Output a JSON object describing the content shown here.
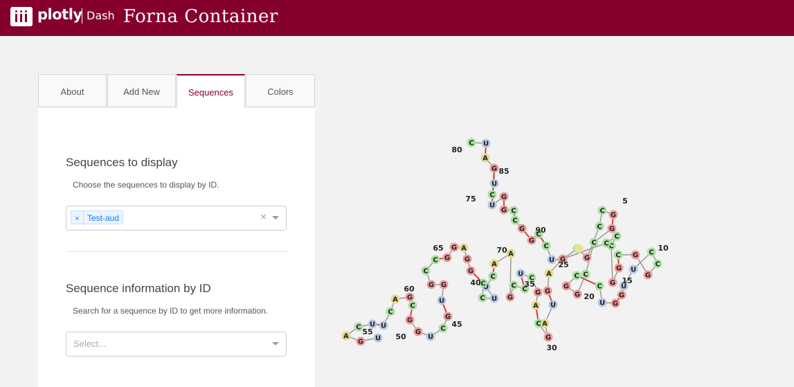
{
  "header": {
    "logo_text": "plotly",
    "logo_product": "Dash",
    "title": "Forna Container",
    "background": "#85002d"
  },
  "tabs": [
    {
      "label": "About",
      "active": false
    },
    {
      "label": "Add New",
      "active": false
    },
    {
      "label": "Sequences",
      "active": true
    },
    {
      "label": "Colors",
      "active": false
    }
  ],
  "sequences_section": {
    "title": "Sequences to display",
    "description": "Choose the sequences to display by ID.",
    "selected_chip": "Test-aud",
    "clear_icon": "×",
    "remove_icon": "×"
  },
  "info_section": {
    "title": "Sequence information by ID",
    "description": "Search for a sequence by ID to get more information.",
    "placeholder": "Select..."
  },
  "colors": {
    "accent": "#85002d",
    "G": "#ee9b9b",
    "C": "#a8e0a0",
    "U": "#b5c8e6",
    "A": "#e6d98c"
  },
  "nucleotides": [
    {
      "b": "C"
    },
    {
      "b": "U"
    },
    {
      "b": "A"
    },
    {
      "b": "G"
    },
    {
      "b": "U"
    },
    {
      "b": "C"
    },
    {
      "b": "U"
    },
    {
      "b": "G"
    },
    {
      "b": "G"
    },
    {
      "b": "C"
    },
    {
      "b": "C"
    },
    {
      "b": "G"
    },
    {
      "b": "G"
    },
    {
      "b": "C"
    },
    {
      "b": "C"
    },
    {
      "b": "U"
    },
    {
      "b": "G"
    },
    {
      "b": "C"
    },
    {
      "b": "G"
    },
    {
      "b": "C"
    },
    {
      "b": "C"
    },
    {
      "b": "G"
    },
    {
      "b": "G"
    },
    {
      "b": "C"
    },
    {
      "b": "C"
    },
    {
      "b": "G"
    },
    {
      "b": "G"
    },
    {
      "b": "C"
    },
    {
      "b": "C"
    },
    {
      "b": "U"
    },
    {
      "b": "G"
    },
    {
      "b": "G"
    },
    {
      "b": "U"
    },
    {
      "b": "U"
    },
    {
      "b": "C"
    },
    {
      "b": "C"
    },
    {
      "b": "G"
    },
    {
      "b": "G"
    },
    {
      "b": "C"
    },
    {
      "b": "G"
    },
    {
      "b": "G"
    },
    {
      "b": "C"
    },
    {
      "b": "C"
    },
    {
      "b": "C"
    },
    {
      "b": "G"
    },
    {
      "b": "A"
    },
    {
      "b": "G"
    },
    {
      "b": "U"
    },
    {
      "b": "A"
    },
    {
      "b": "G"
    },
    {
      "b": "C"
    },
    {
      "b": "A"
    },
    {
      "b": "G"
    },
    {
      "b": "C"
    },
    {
      "b": "U"
    },
    {
      "b": "C"
    },
    {
      "b": "C"
    },
    {
      "b": "G"
    },
    {
      "b": "A"
    },
    {
      "b": "A"
    },
    {
      "b": "C"
    },
    {
      "b": "U"
    },
    {
      "b": "U"
    },
    {
      "b": "C"
    },
    {
      "b": "C"
    },
    {
      "b": "G"
    },
    {
      "b": "G"
    },
    {
      "b": "A"
    },
    {
      "b": "G"
    },
    {
      "b": "G"
    },
    {
      "b": "C"
    },
    {
      "b": "C"
    },
    {
      "b": "G"
    },
    {
      "b": "G"
    },
    {
      "b": "U"
    },
    {
      "b": "G"
    },
    {
      "b": "C"
    },
    {
      "b": "U"
    },
    {
      "b": "G"
    },
    {
      "b": "G"
    },
    {
      "b": "C"
    },
    {
      "b": "G"
    },
    {
      "b": "A"
    },
    {
      "b": "C"
    },
    {
      "b": "U"
    },
    {
      "b": "U"
    },
    {
      "b": "C"
    },
    {
      "b": "A"
    },
    {
      "b": "G"
    },
    {
      "b": "U"
    }
  ],
  "index_labels": [
    "5",
    "10",
    "15",
    "20",
    "25",
    "30",
    "35",
    "40",
    "45",
    "50",
    "55",
    "60",
    "65",
    "70",
    "75",
    "80",
    "85",
    "90"
  ]
}
